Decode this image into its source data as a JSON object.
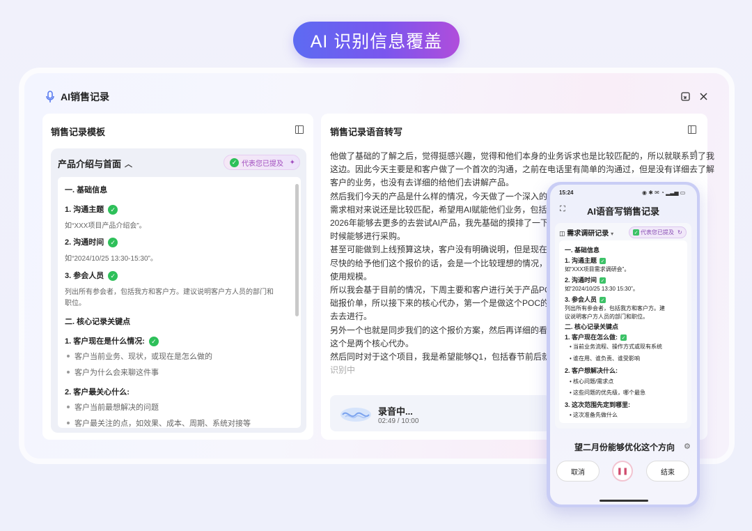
{
  "hero": {
    "title": "AI 识别信息覆盖"
  },
  "window": {
    "title": "AI销售记录"
  },
  "left": {
    "title": "销售记录模板",
    "section": "产品介绍与首面",
    "badge": "代表您已提及",
    "items": [
      {
        "text": "一. 基础信息"
      },
      {
        "text": "1. 沟通主题"
      },
      {
        "text": "如“XXX项目产品介绍会”。"
      },
      {
        "text": "2. 沟通时间"
      },
      {
        "text": "如“2024/10/25 13:30-15:30”。"
      },
      {
        "text": "3. 参会人员"
      },
      {
        "text": "列出所有参会者，包括我方和客户方。建议说明客户方人员的部门和"
      },
      {
        "text": "职位。"
      },
      {
        "text": "二. 核心记录关键点"
      },
      {
        "text": "1. 客户现在是什么情况:"
      },
      {
        "text": "客户当前业务、现状，或现在是怎么做的"
      },
      {
        "text": "客户为什么会来聊这件事"
      },
      {
        "text": "2. 客户最关心什么:"
      },
      {
        "text": "客户当前最想解决的问题"
      },
      {
        "text": "客户最关注的点，如效果、成本、周期、系统对接等"
      }
    ]
  },
  "right": {
    "title": "销售记录语音转写",
    "lines": [
      "他做了基础的了解之后，觉得挺感兴趣，觉得和他们本身的业务诉求也是比较匹配的，所以就联系到了我",
      "这边。因此今天主要是和客户做了一个首次的沟通，之前在电话里有简单的沟通过，但是没有详细去了解",
      "客户的业务，也没有去详细的给他们去讲解产品。",
      "然后我们今天的产品是什么样的情况，今天做了一个深入的交流",
      "需求相对来说还是比较匹配，希望用AI赋能他们业务，包括销售",
      "2026年能够去更多的去尝试AI产品，我先基础的摸排了一下客户",
      "时候能够进行采购。",
      "甚至可能做到上线预算这块，客户没有明确说明，但是现在也可",
      "尽快的给予他们这个报价的话，会是一个比较理想的情况，同时",
      "使用规模。",
      "所以我会基于目前的情况，下周主要和客户进行关于产品POC和",
      "础报价单，所以接下来的核心代办，第一个是做这个POC的准备",
      "去去进行。",
      "另外一个也就是同步我们的这个报价方案，然后再详细的看一下",
      "这个是两个核心代办。",
      "然后同时对于这个项目，我是希望能够Q1，包括春节前后就能够",
      "识别中"
    ],
    "recording": {
      "status": "录音中...",
      "time": "02:49 / 10:00"
    }
  },
  "phone": {
    "time": "15:24",
    "title": "AI语音写销售记录",
    "template": "需求调研记录",
    "badge": "代表您已提及",
    "lines": [
      "一. 基础信息",
      "1. 沟通主题",
      "如“XXX项目需求调研会”。",
      "2. 沟通时间",
      "如“2024/10/25 13:30 15:30”。",
      "3. 参会人员",
      "列出所有参会者，包括我方和客户方。建",
      "议说明客户方人员的部门和职位。",
      "二. 核心记录关键点",
      "1. 客户现在怎么做:",
      "当前业务流程、操作方式或现有系统",
      "谁在用、谁负责、谁受影响",
      "2. 客户想解决什么:",
      "核心问题/需求点",
      "这些问题的优先级，哪个最急",
      "3. 这次范围先定到哪里:",
      "这次准备先做什么"
    ],
    "transcript": "望二月份能够优化这个方向",
    "cancel": "取消",
    "end": "结束"
  }
}
